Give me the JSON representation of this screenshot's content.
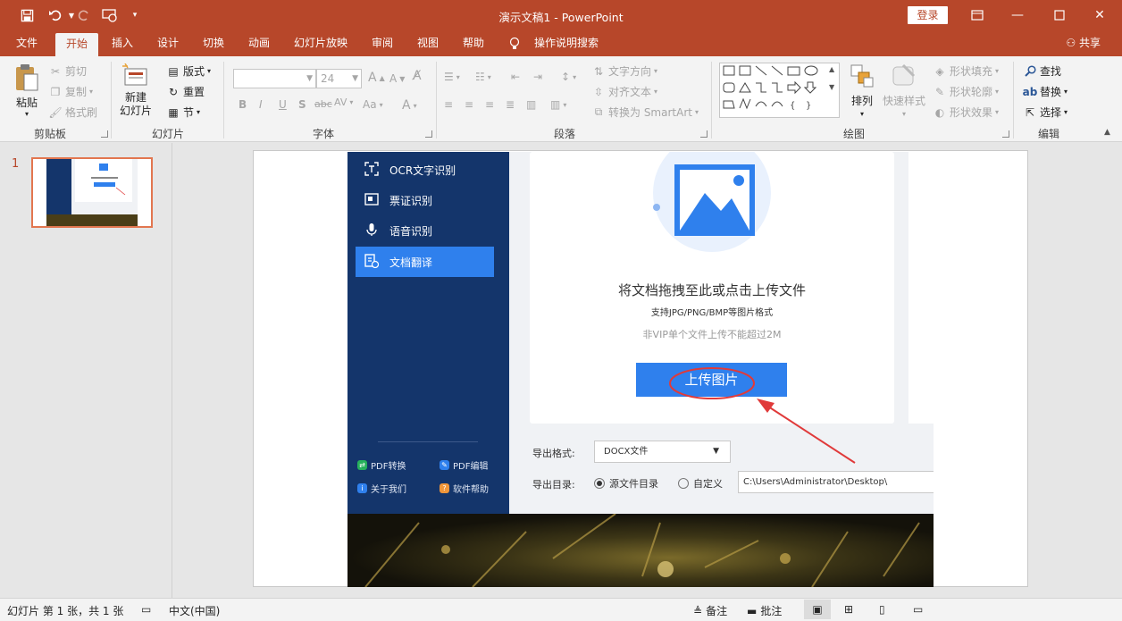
{
  "window": {
    "title": "演示文稿1 - PowerPoint",
    "login_label": "登录",
    "share_label": "共享",
    "icons": [
      "save-icon",
      "undo-icon",
      "redo-icon",
      "start-from-beginning-icon",
      "customize-quick-access-icon",
      "ribbon-display-options-icon",
      "minimize-icon",
      "maximize-icon",
      "close-icon"
    ]
  },
  "tabs": [
    "文件",
    "开始",
    "插入",
    "设计",
    "切换",
    "动画",
    "幻灯片放映",
    "审阅",
    "视图",
    "帮助",
    "操作说明搜索"
  ],
  "active_tab": "开始",
  "ribbon": {
    "clipboard": {
      "paste": "粘贴",
      "cut": "剪切",
      "copy": "复制",
      "format_painter": "格式刷",
      "group": "剪贴板"
    },
    "slides": {
      "new_slide": "新建\n幻灯片",
      "layout": "版式",
      "reset": "重置",
      "section": "节",
      "group": "幻灯片"
    },
    "font": {
      "font_name": "",
      "font_size": "24",
      "bold": "B",
      "italic": "I",
      "underline": "U",
      "shadow": "S",
      "strike": "abc",
      "spacing": "AV",
      "case": "Aa",
      "color": "A",
      "group": "字体"
    },
    "paragraph": {
      "text_direction": "文字方向",
      "align_text": "对齐文本",
      "convert_smartart": "转换为 SmartArt",
      "group": "段落"
    },
    "drawing": {
      "arrange": "排列",
      "quick_styles": "快速样式",
      "shape_fill": "形状填充",
      "shape_outline": "形状轮廓",
      "shape_effects": "形状效果",
      "group": "绘图"
    },
    "editing": {
      "find": "查找",
      "replace": "替换",
      "select": "选择",
      "group": "编辑"
    }
  },
  "slide_panel": {
    "slide_number": "1"
  },
  "slide_content": {
    "sidebar_items": [
      {
        "label": "OCR文字识别",
        "icon": "ocr-icon"
      },
      {
        "label": "票证识别",
        "icon": "ticket-icon"
      },
      {
        "label": "语音识别",
        "icon": "microphone-icon"
      },
      {
        "label": "文档翻译",
        "icon": "translate-icon"
      }
    ],
    "active_item": "文档翻译",
    "footer_links": [
      {
        "label": "PDF转换",
        "color": "#27b05c"
      },
      {
        "label": "PDF编辑",
        "color": "#2f80ed"
      },
      {
        "label": "关于我们",
        "color": "#2f80ed"
      },
      {
        "label": "软件帮助",
        "color": "#f0963a"
      }
    ],
    "upload": {
      "title": "将文档拖拽至此或点击上传文件",
      "formats": "支持JPG/PNG/BMP等图片格式",
      "limit": "非VIP单个文件上传不能超过2M",
      "button": "上传图片"
    },
    "export_format_label": "导出格式:",
    "export_format_value": "DOCX文件",
    "export_dir_label": "导出目录:",
    "radio_source": "源文件目录",
    "radio_custom": "自定义",
    "path_value": "C:\\Users\\Administrator\\Desktop\\",
    "annotation_color": "#e03a3a"
  },
  "status": {
    "slide_info": "幻灯片 第 1 张，共 1 张",
    "language": "中文(中国)",
    "notes": "备注",
    "comments": "批注"
  },
  "colors": {
    "accent": "#b7472a",
    "blue": "#2f80ed",
    "navy": "#14356b"
  }
}
